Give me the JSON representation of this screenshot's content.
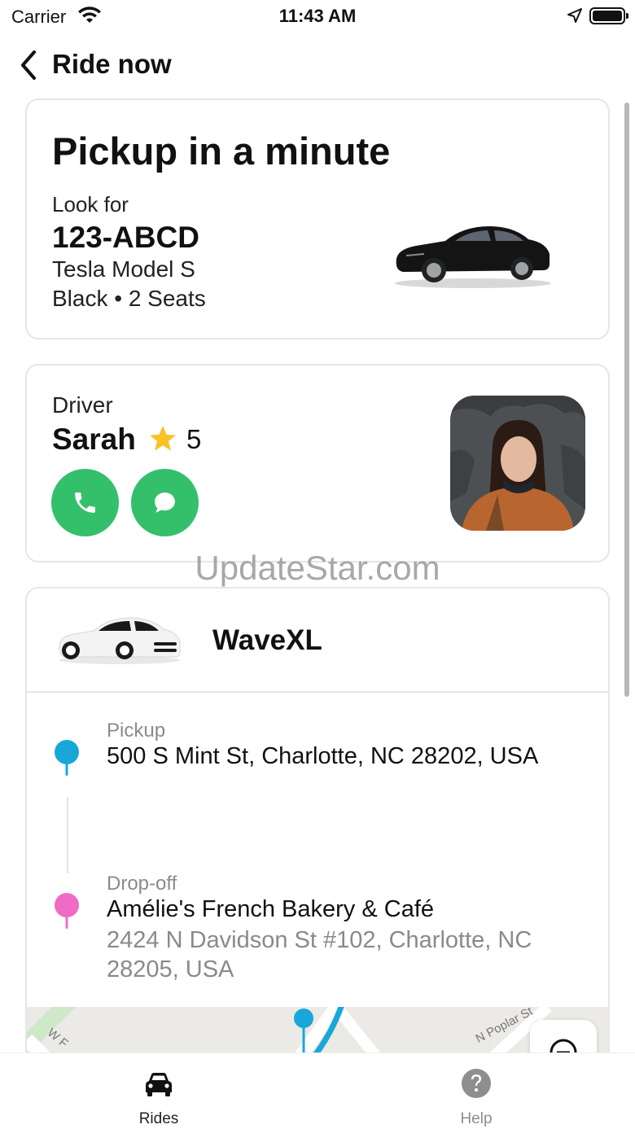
{
  "status_bar": {
    "carrier": "Carrier",
    "time": "11:43 AM",
    "wifi_icon": "wifi-icon",
    "location_icon": "location-arrow-icon",
    "battery_icon": "battery-full-icon"
  },
  "nav": {
    "back_icon": "chevron-left-icon",
    "title": "Ride now"
  },
  "pickup_card": {
    "headline": "Pickup in a minute",
    "look_for_label": "Look for",
    "plate": "123-ABCD",
    "model": "Tesla Model S",
    "details": "Black • 2 Seats",
    "car_image": "black-sedan-photo"
  },
  "driver_card": {
    "label": "Driver",
    "name": "Sarah",
    "rating_icon": "star-icon",
    "rating": "5",
    "call_icon": "phone-icon",
    "message_icon": "chat-bubble-icon",
    "avatar": "driver-photo"
  },
  "watermark": "UpdateStar.com",
  "ride_card": {
    "car_image": "white-car-icon",
    "ride_type": "WaveXL",
    "pickup": {
      "label": "Pickup",
      "address": "500 S Mint St, Charlotte, NC 28202, USA",
      "pin_color": "#17a8d8"
    },
    "dropoff": {
      "label": "Drop-off",
      "name": "Amélie's French Bakery & Café",
      "address": "2424 N Davidson St #102, Charlotte, NC 28205, USA",
      "pin_color": "#f06bc6"
    },
    "map": {
      "street_1": "W F",
      "street_2": "N Poplar St",
      "recenter_icon": "recenter-icon"
    }
  },
  "tab_bar": {
    "tabs": [
      {
        "label": "Rides",
        "icon": "car-icon",
        "active": true
      },
      {
        "label": "Help",
        "icon": "question-circle-icon",
        "active": false
      }
    ]
  },
  "colors": {
    "accent_green": "#34c06b",
    "star_yellow": "#f7c325",
    "route_blue": "#17a8d8"
  }
}
